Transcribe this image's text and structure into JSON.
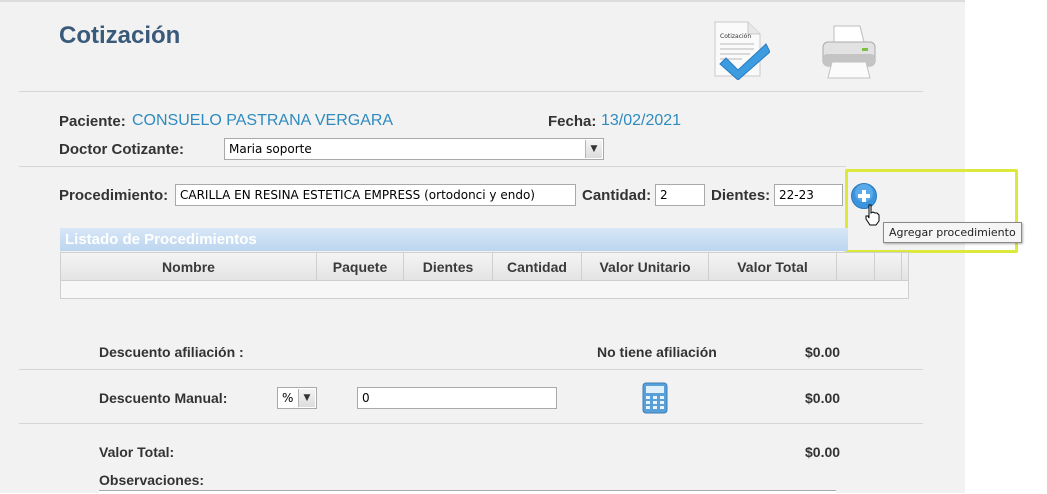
{
  "header": {
    "title": "Cotización",
    "quote_icon_caption": "Cotización"
  },
  "patient": {
    "label": "Paciente:",
    "name": "CONSUELO PASTRANA VERGARA",
    "date_label": "Fecha:",
    "date": "13/02/2021"
  },
  "doctor": {
    "label": "Doctor Cotizante:",
    "selected": "Maria soporte"
  },
  "procedure": {
    "label": "Procedimiento:",
    "value": "CARILLA EN RESINA ESTETICA EMPRESS (ortodonci y endo)",
    "quantity_label": "Cantidad:",
    "quantity": "2",
    "teeth_label": "Dientes:",
    "teeth": "22-23",
    "add_tooltip": "Agregar procedimiento"
  },
  "list": {
    "title": "Listado de Procedimientos",
    "columns": [
      "Nombre",
      "Paquete",
      "Dientes",
      "Cantidad",
      "Valor Unitario",
      "Valor Total"
    ]
  },
  "discounts": {
    "affiliation_label": "Descuento afiliación :",
    "affiliation_status": "No tiene afiliación",
    "affiliation_amount": "$0.00",
    "manual_label": "Descuento Manual:",
    "manual_type": "%",
    "manual_value": "0",
    "manual_amount": "$0.00"
  },
  "totals": {
    "total_label": "Valor Total:",
    "total_amount": "$0.00",
    "observations_label": "Observaciones:"
  },
  "colors": {
    "title": "#3a5a7a",
    "value_text": "#2e8bbf",
    "highlight": "#dce83a",
    "list_header": "#bcd5ef"
  }
}
